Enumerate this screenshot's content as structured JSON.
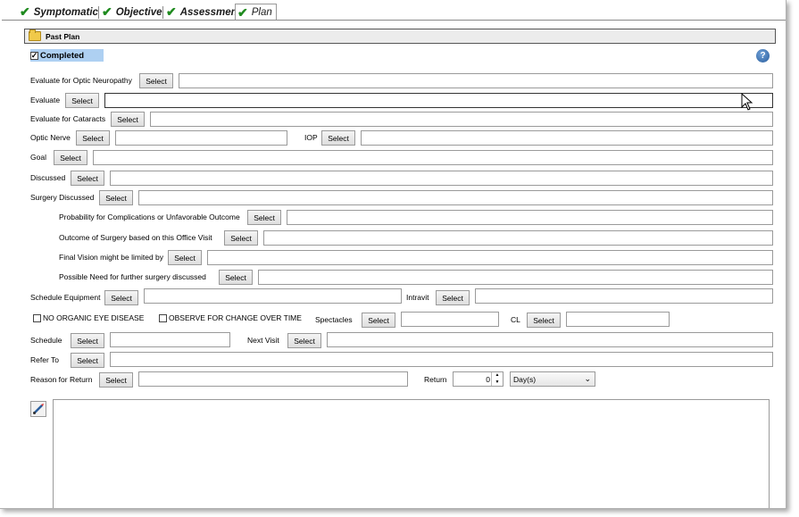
{
  "tabs": [
    {
      "label": "Symptomatic",
      "checked": true
    },
    {
      "label": "Objective",
      "checked": true
    },
    {
      "label": "Assessment",
      "checked": true
    },
    {
      "label": "Plan",
      "checked": true,
      "active": true
    }
  ],
  "past_plan": {
    "label": "Past Plan",
    "icon": "folder-icon"
  },
  "completed": {
    "label": "Completed",
    "checked": true
  },
  "help": {
    "icon": "help-icon",
    "glyph": "?"
  },
  "select_label": "Select",
  "fields": {
    "evaluate_optic_neuropathy": {
      "label": "Evaluate for Optic Neuropathy",
      "value": ""
    },
    "evaluate": {
      "label": "Evaluate",
      "value": ""
    },
    "evaluate_cataracts": {
      "label": "Evaluate for Cataracts",
      "value": ""
    },
    "optic_nerve": {
      "label": "Optic Nerve",
      "value": ""
    },
    "iop": {
      "label": "IOP",
      "value": ""
    },
    "goal": {
      "label": "Goal",
      "value": ""
    },
    "discussed": {
      "label": "Discussed",
      "value": ""
    },
    "surgery_discussed": {
      "label": "Surgery Discussed",
      "value": ""
    },
    "probability_complications": {
      "label": "Probability for Complications or Unfavorable Outcome",
      "value": ""
    },
    "outcome_surgery": {
      "label": "Outcome of Surgery based on this Office Visit",
      "value": ""
    },
    "final_vision": {
      "label": "Final Vision might be limited by",
      "value": ""
    },
    "possible_need": {
      "label": "Possible Need for further surgery discussed",
      "value": ""
    },
    "schedule_equipment": {
      "label": "Schedule Equipment",
      "value": ""
    },
    "intravit": {
      "label": "Intravit",
      "value": ""
    },
    "spectacles": {
      "label": "Spectacles",
      "value": ""
    },
    "cl": {
      "label": "CL",
      "value": ""
    },
    "schedule": {
      "label": "Schedule",
      "value": ""
    },
    "next_visit": {
      "label": "Next Visit",
      "value": ""
    },
    "refer_to": {
      "label": "Refer To",
      "value": ""
    },
    "reason_for_return": {
      "label": "Reason for Return",
      "value": ""
    }
  },
  "checkboxes": {
    "no_organic_eye_disease": {
      "label": "NO ORGANIC EYE DISEASE",
      "checked": false
    },
    "observe_for_change": {
      "label": "OBSERVE FOR CHANGE OVER TIME",
      "checked": false
    }
  },
  "return": {
    "label": "Return",
    "value": "0",
    "unit": "Day(s)"
  },
  "notes": {
    "value": ""
  },
  "colors": {
    "check": "#1e8a1e",
    "completed_bg": "#aed0f2",
    "help": "#2a5e9e"
  }
}
